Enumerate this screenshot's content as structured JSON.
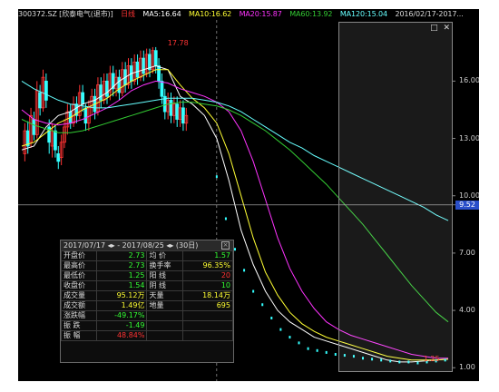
{
  "header": {
    "stock": "300372.SZ [欣泰电气(退市)]",
    "mode": "日线",
    "ma5": "MA5:16.64",
    "ma10": "MA10:16.62",
    "ma20": "MA20:15.87",
    "ma60": "MA60:13.92",
    "ma120": "MA120:15.04",
    "date": "2016/02/17-2017..."
  },
  "colors": {
    "ma5": "#ffffff",
    "ma10": "#ffff33",
    "ma20": "#ff33ff",
    "ma60": "#33cc33",
    "ma120": "#66ffff",
    "up": "#ff3333",
    "down": "#33ffff",
    "price_tag": "#2a4fc9"
  },
  "chart_data": {
    "type": "line",
    "ylim": [
      0.3,
      19.2
    ],
    "yticks": [
      "16.00",
      "13.00",
      "10.00",
      "7.00",
      "4.00",
      "1.00"
    ],
    "ytick_values": [
      16,
      13,
      10,
      7,
      4,
      1
    ],
    "current_price": "9.52",
    "current_price_value": 9.52,
    "annotations": [
      {
        "label": "17.78",
        "x": 47,
        "y": 17.78
      },
      {
        "label": "1.25",
        "x": 131,
        "y": 1.25
      }
    ],
    "x": [
      0,
      4,
      8,
      12,
      16,
      20,
      24,
      28,
      32,
      36,
      40,
      44,
      48,
      52,
      56,
      60,
      64,
      68,
      72,
      76,
      80,
      84,
      88,
      92,
      96,
      100,
      104,
      108,
      112,
      116,
      120,
      124,
      128,
      132,
      136,
      140
    ],
    "series": [
      {
        "name": "MA5",
        "color_key": "ma5",
        "values": [
          12.4,
          12.6,
          13.6,
          14.2,
          14.4,
          14.8,
          15.0,
          15.4,
          16.0,
          16.4,
          16.6,
          16.8,
          16.6,
          15.2,
          14.8,
          14.2,
          13.0,
          10.8,
          8.2,
          6.4,
          5.0,
          4.0,
          3.4,
          3.0,
          2.6,
          2.4,
          2.2,
          2.0,
          1.8,
          1.6,
          1.4,
          1.3,
          1.3,
          1.35,
          1.4,
          1.45
        ]
      },
      {
        "name": "MA10",
        "color_key": "ma10",
        "values": [
          12.6,
          12.8,
          13.3,
          13.8,
          14.1,
          14.5,
          14.8,
          15.1,
          15.6,
          16.0,
          16.3,
          16.6,
          16.6,
          15.8,
          15.1,
          14.6,
          13.8,
          12.2,
          10.0,
          7.8,
          6.0,
          4.8,
          3.9,
          3.3,
          2.9,
          2.6,
          2.4,
          2.2,
          2.0,
          1.8,
          1.6,
          1.5,
          1.4,
          1.4,
          1.4,
          1.45
        ]
      },
      {
        "name": "MA20",
        "color_key": "ma20",
        "values": [
          14.5,
          14.0,
          13.8,
          13.7,
          13.8,
          14.0,
          14.3,
          14.6,
          15.0,
          15.5,
          15.8,
          16.0,
          15.9,
          15.6,
          15.4,
          15.2,
          14.9,
          14.4,
          13.4,
          11.8,
          9.8,
          7.8,
          6.2,
          5.0,
          4.1,
          3.4,
          3.0,
          2.7,
          2.5,
          2.3,
          2.1,
          1.9,
          1.7,
          1.6,
          1.5,
          1.5
        ]
      },
      {
        "name": "MA60",
        "color_key": "ma60",
        "values": [
          14.0,
          13.7,
          13.5,
          13.3,
          13.3,
          13.4,
          13.6,
          13.8,
          14.0,
          14.2,
          14.4,
          14.6,
          14.8,
          14.9,
          14.9,
          14.8,
          14.7,
          14.5,
          14.2,
          13.8,
          13.4,
          12.9,
          12.4,
          11.8,
          11.2,
          10.6,
          9.9,
          9.2,
          8.5,
          7.7,
          6.9,
          6.1,
          5.3,
          4.6,
          3.9,
          3.4
        ]
      },
      {
        "name": "MA120",
        "color_key": "ma120",
        "values": [
          16.0,
          15.6,
          15.3,
          15.0,
          14.8,
          14.7,
          14.6,
          14.6,
          14.7,
          14.8,
          14.9,
          15.0,
          15.1,
          15.1,
          15.1,
          15.0,
          14.9,
          14.7,
          14.4,
          14.0,
          13.6,
          13.2,
          12.8,
          12.5,
          12.1,
          11.8,
          11.5,
          11.2,
          10.9,
          10.6,
          10.3,
          10.0,
          9.7,
          9.4,
          9.0,
          8.7
        ]
      }
    ],
    "candles": [
      {
        "x": 0,
        "o": 12.2,
        "c": 13.4,
        "h": 13.8,
        "l": 11.8
      },
      {
        "x": 1,
        "o": 13.4,
        "c": 12.6,
        "h": 13.9,
        "l": 12.2
      },
      {
        "x": 2,
        "o": 12.8,
        "c": 14.2,
        "h": 14.6,
        "l": 12.5
      },
      {
        "x": 3,
        "o": 14.0,
        "c": 13.2,
        "h": 14.4,
        "l": 12.9
      },
      {
        "x": 4,
        "o": 13.2,
        "c": 15.5,
        "h": 16.0,
        "l": 13.0
      },
      {
        "x": 5,
        "o": 15.4,
        "c": 14.6,
        "h": 15.8,
        "l": 14.2
      },
      {
        "x": 6,
        "o": 14.6,
        "c": 16.2,
        "h": 16.6,
        "l": 14.4
      },
      {
        "x": 7,
        "o": 16.0,
        "c": 15.0,
        "h": 16.4,
        "l": 14.6
      },
      {
        "x": 8,
        "o": 13.6,
        "c": 12.8,
        "h": 14.0,
        "l": 12.2
      },
      {
        "x": 9,
        "o": 12.6,
        "c": 13.4,
        "h": 13.8,
        "l": 12.0
      },
      {
        "x": 10,
        "o": 13.4,
        "c": 12.4,
        "h": 13.7,
        "l": 12.0
      },
      {
        "x": 11,
        "o": 12.2,
        "c": 11.8,
        "h": 12.6,
        "l": 11.4
      },
      {
        "x": 12,
        "o": 12.0,
        "c": 12.8,
        "h": 13.2,
        "l": 11.6
      },
      {
        "x": 13,
        "o": 12.8,
        "c": 13.6,
        "h": 14.0,
        "l": 12.5
      },
      {
        "x": 14,
        "o": 13.6,
        "c": 14.4,
        "h": 14.8,
        "l": 13.2
      },
      {
        "x": 15,
        "o": 14.4,
        "c": 13.8,
        "h": 14.8,
        "l": 13.5
      },
      {
        "x": 16,
        "o": 13.8,
        "c": 14.8,
        "h": 15.2,
        "l": 13.6
      },
      {
        "x": 17,
        "o": 14.8,
        "c": 14.2,
        "h": 15.2,
        "l": 13.8
      },
      {
        "x": 18,
        "o": 14.2,
        "c": 15.4,
        "h": 15.8,
        "l": 14.0
      },
      {
        "x": 19,
        "o": 15.4,
        "c": 14.8,
        "h": 15.8,
        "l": 14.4
      },
      {
        "x": 20,
        "o": 14.6,
        "c": 13.8,
        "h": 14.8,
        "l": 13.4
      },
      {
        "x": 21,
        "o": 13.8,
        "c": 14.6,
        "h": 15.0,
        "l": 13.4
      },
      {
        "x": 22,
        "o": 14.6,
        "c": 15.2,
        "h": 15.6,
        "l": 14.2
      },
      {
        "x": 23,
        "o": 15.2,
        "c": 14.4,
        "h": 15.6,
        "l": 14.0
      },
      {
        "x": 24,
        "o": 14.4,
        "c": 15.8,
        "h": 16.2,
        "l": 14.2
      },
      {
        "x": 25,
        "o": 15.8,
        "c": 15.0,
        "h": 16.2,
        "l": 14.6
      },
      {
        "x": 26,
        "o": 15.0,
        "c": 16.0,
        "h": 16.4,
        "l": 14.8
      },
      {
        "x": 27,
        "o": 16.0,
        "c": 15.2,
        "h": 16.4,
        "l": 14.8
      },
      {
        "x": 28,
        "o": 15.4,
        "c": 16.4,
        "h": 16.8,
        "l": 15.0
      },
      {
        "x": 29,
        "o": 16.4,
        "c": 15.6,
        "h": 16.8,
        "l": 15.2
      },
      {
        "x": 30,
        "o": 15.6,
        "c": 16.2,
        "h": 16.6,
        "l": 15.2
      },
      {
        "x": 31,
        "o": 16.2,
        "c": 15.4,
        "h": 16.6,
        "l": 15.0
      },
      {
        "x": 32,
        "o": 15.4,
        "c": 16.6,
        "h": 17.0,
        "l": 15.2
      },
      {
        "x": 33,
        "o": 16.6,
        "c": 15.8,
        "h": 17.0,
        "l": 15.4
      },
      {
        "x": 34,
        "o": 15.8,
        "c": 16.8,
        "h": 17.2,
        "l": 15.6
      },
      {
        "x": 35,
        "o": 16.8,
        "c": 16.0,
        "h": 17.2,
        "l": 15.6
      },
      {
        "x": 36,
        "o": 16.0,
        "c": 17.0,
        "h": 17.4,
        "l": 15.8
      },
      {
        "x": 37,
        "o": 17.0,
        "c": 16.2,
        "h": 17.4,
        "l": 15.8
      },
      {
        "x": 38,
        "o": 16.2,
        "c": 17.2,
        "h": 17.6,
        "l": 16.0
      },
      {
        "x": 39,
        "o": 17.2,
        "c": 16.4,
        "h": 17.6,
        "l": 16.0
      },
      {
        "x": 40,
        "o": 16.4,
        "c": 17.4,
        "h": 17.7,
        "l": 16.2
      },
      {
        "x": 41,
        "o": 17.4,
        "c": 16.6,
        "h": 17.7,
        "l": 16.2
      },
      {
        "x": 42,
        "o": 16.6,
        "c": 17.6,
        "h": 17.78,
        "l": 16.4
      },
      {
        "x": 43,
        "o": 17.6,
        "c": 16.8,
        "h": 17.78,
        "l": 16.4
      },
      {
        "x": 44,
        "o": 16.8,
        "c": 16.0,
        "h": 17.2,
        "l": 15.6
      },
      {
        "x": 45,
        "o": 16.0,
        "c": 15.2,
        "h": 16.4,
        "l": 14.8
      },
      {
        "x": 46,
        "o": 15.2,
        "c": 14.4,
        "h": 15.6,
        "l": 14.0
      },
      {
        "x": 47,
        "o": 14.4,
        "c": 15.0,
        "h": 15.4,
        "l": 14.0
      },
      {
        "x": 48,
        "o": 15.0,
        "c": 14.2,
        "h": 15.4,
        "l": 13.8
      },
      {
        "x": 49,
        "o": 14.2,
        "c": 14.8,
        "h": 15.2,
        "l": 13.8
      },
      {
        "x": 50,
        "o": 14.8,
        "c": 14.0,
        "h": 15.2,
        "l": 13.6
      },
      {
        "x": 51,
        "o": 14.0,
        "c": 14.6,
        "h": 15.0,
        "l": 13.6
      },
      {
        "x": 52,
        "o": 14.6,
        "c": 13.8,
        "h": 15.0,
        "l": 13.4
      },
      {
        "x": 53,
        "o": 13.8,
        "c": 14.2,
        "h": 14.6,
        "l": 13.4
      }
    ],
    "tail_points": [
      {
        "x": 64,
        "y": 11.0
      },
      {
        "x": 67,
        "y": 8.8
      },
      {
        "x": 70,
        "y": 7.2
      },
      {
        "x": 73,
        "y": 6.1
      },
      {
        "x": 76,
        "y": 5.0
      },
      {
        "x": 79,
        "y": 4.3
      },
      {
        "x": 82,
        "y": 3.6
      },
      {
        "x": 85,
        "y": 3.0
      },
      {
        "x": 88,
        "y": 2.6
      },
      {
        "x": 91,
        "y": 2.3
      },
      {
        "x": 94,
        "y": 2.0
      },
      {
        "x": 97,
        "y": 1.9
      },
      {
        "x": 100,
        "y": 1.8
      },
      {
        "x": 103,
        "y": 1.7
      },
      {
        "x": 106,
        "y": 1.65
      },
      {
        "x": 109,
        "y": 1.6
      },
      {
        "x": 112,
        "y": 1.5
      },
      {
        "x": 115,
        "y": 1.45
      },
      {
        "x": 118,
        "y": 1.4
      },
      {
        "x": 121,
        "y": 1.35
      },
      {
        "x": 124,
        "y": 1.3
      },
      {
        "x": 127,
        "y": 1.3
      },
      {
        "x": 130,
        "y": 1.25
      },
      {
        "x": 133,
        "y": 1.3
      },
      {
        "x": 136,
        "y": 1.35
      },
      {
        "x": 139,
        "y": 1.4
      }
    ]
  },
  "panel": {
    "range_start": "2017/07/17",
    "range_end": "2017/08/25",
    "days": "(30日)",
    "rows": [
      {
        "l1": "开盘价",
        "v1": "2.73",
        "c1": "#33ff33",
        "l2": "均 价",
        "v2": "1.57",
        "c2": "#33ff33"
      },
      {
        "l1": "最高价",
        "v1": "2.73",
        "c1": "#33ff33",
        "l2": "换手率",
        "v2": "96.35%",
        "c2": "#ffff33"
      },
      {
        "l1": "最低价",
        "v1": "1.25",
        "c1": "#33ff33",
        "l2": "阳 线",
        "v2": "20",
        "c2": "#ff3333"
      },
      {
        "l1": "收盘价",
        "v1": "1.54",
        "c1": "#33ff33",
        "l2": "阴 线",
        "v2": "10",
        "c2": "#33ff33"
      },
      {
        "l1": "成交量",
        "v1": "95.12万",
        "c1": "#ffff33",
        "l2": "天量",
        "v2": "18.14万",
        "c2": "#ffff33"
      },
      {
        "l1": "成交额",
        "v1": "1.49亿",
        "c1": "#ffff33",
        "l2": "地量",
        "v2": "695",
        "c2": "#ffff33"
      },
      {
        "l1": "涨跌幅",
        "v1": "-49.17%",
        "c1": "#33ff33",
        "l2": "",
        "v2": "",
        "c2": "#ddd"
      },
      {
        "l1": "振 跌",
        "v1": "-1.49",
        "c1": "#33ff33",
        "l2": "",
        "v2": "",
        "c2": "#ddd"
      },
      {
        "l1": "振 幅",
        "v1": "48.84%",
        "c1": "#ff3333",
        "l2": "",
        "v2": "",
        "c2": "#ddd"
      }
    ]
  },
  "sel_buttons": {
    "restore": "□",
    "close": "✕"
  }
}
